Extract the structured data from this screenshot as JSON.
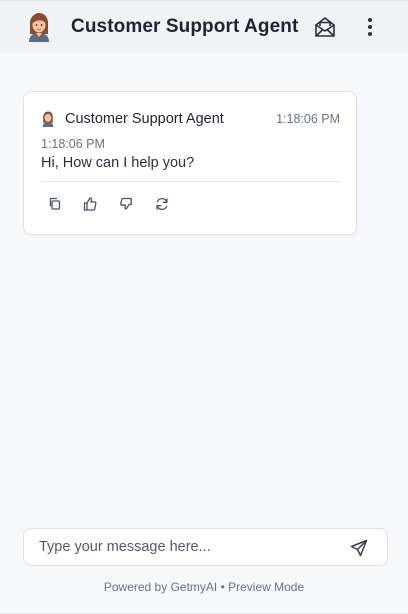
{
  "header": {
    "title": "Customer Support Agent",
    "avatar_icon": "agent-avatar-icon",
    "mail_icon": "envelope-open-icon",
    "more_icon": "vertical-dots-icon"
  },
  "messages": [
    {
      "sender": "Customer Support Agent",
      "time_header": "1:18:06 PM",
      "time": "1:18:06 PM",
      "text": "Hi, How can I help you?",
      "actions": [
        "copy-icon",
        "thumbs-up-icon",
        "thumbs-down-icon",
        "refresh-icon"
      ]
    }
  ],
  "composer": {
    "placeholder": "Type your message here...",
    "value": "",
    "send_icon": "send-icon"
  },
  "footer": {
    "text": "Powered by GetmyAI • Preview Mode"
  },
  "colors": {
    "background": "#f7f8fa",
    "header_bg": "#f1f2f4",
    "text_primary": "#1f2430",
    "text_muted": "#6b7280"
  }
}
